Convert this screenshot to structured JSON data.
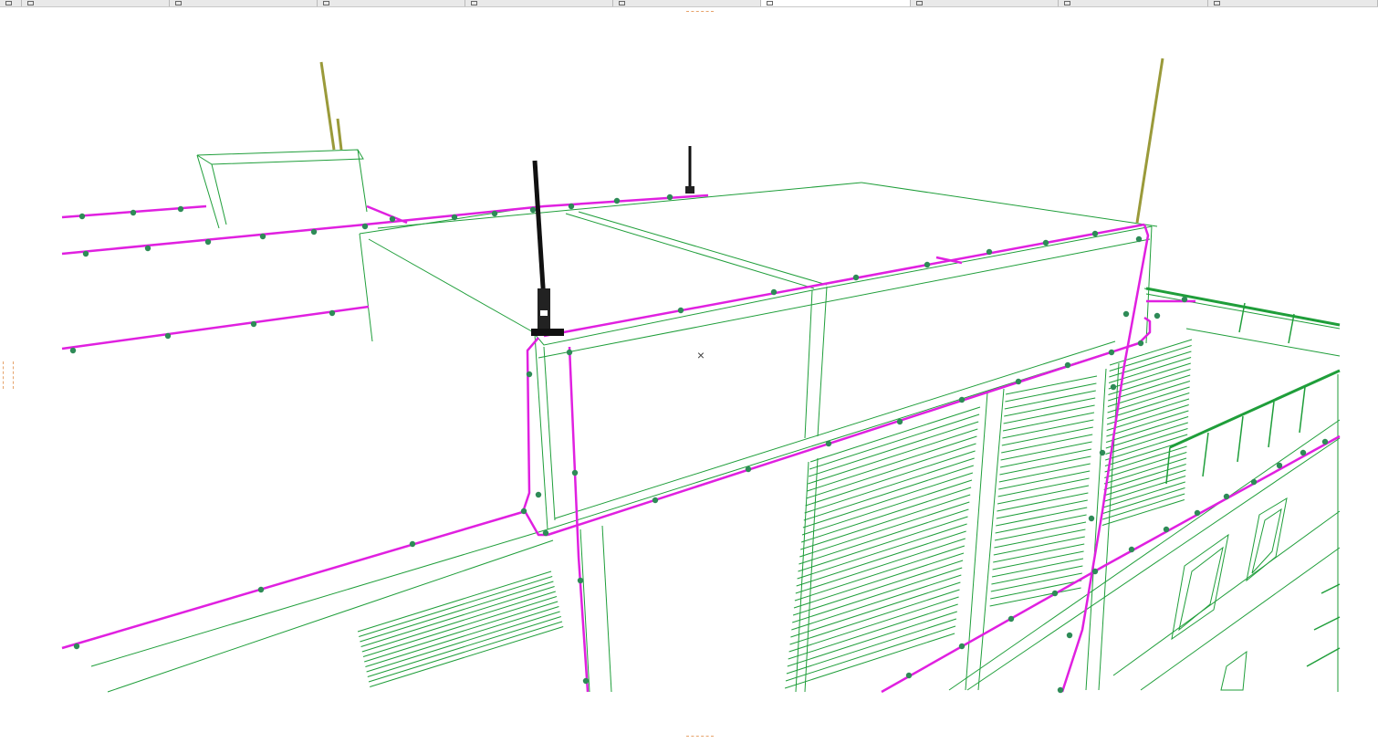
{
  "window": {
    "title": ""
  },
  "tabs": [
    {
      "label": "",
      "icon": "grid-icon",
      "active": false
    },
    {
      "label": "",
      "icon": "plan-icon",
      "active": false
    },
    {
      "label": "",
      "icon": "floor-icon",
      "active": false
    },
    {
      "label": "",
      "icon": "section-icon",
      "active": false
    },
    {
      "label": "",
      "icon": "3d-icon",
      "active": false
    },
    {
      "label": "",
      "icon": "elevation-icon",
      "active": false
    },
    {
      "label": "",
      "icon": "3d-perspective-icon",
      "active": true
    },
    {
      "label": "",
      "icon": "layout-icon",
      "active": false
    },
    {
      "label": "",
      "icon": "check-view-icon",
      "active": false
    },
    {
      "label": "",
      "icon": "structure-icon",
      "active": false
    }
  ],
  "viewport": {
    "mode": "3D wireframe",
    "cursor": "×",
    "colors": {
      "building_lines": "#1f9e3a",
      "conductor": "#e020e0",
      "clips": "#2e8b57",
      "air_terminal": "#9a9a3a",
      "mast": "#111111"
    }
  }
}
